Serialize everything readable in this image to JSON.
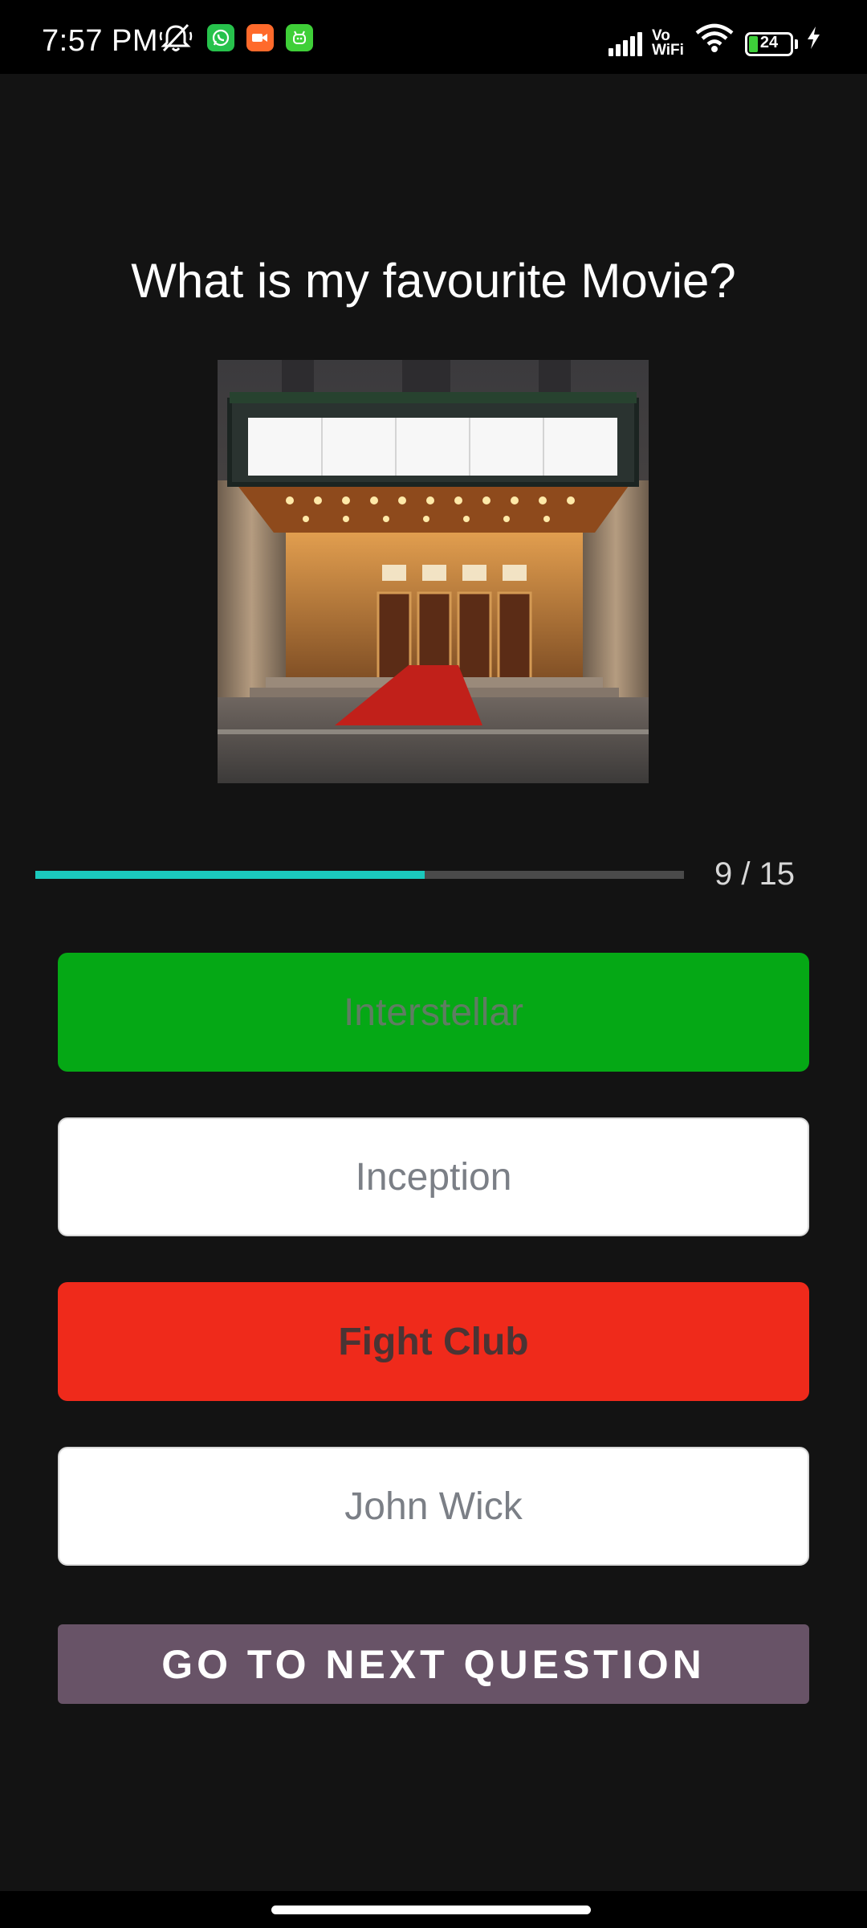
{
  "status_bar": {
    "time": "7:57 PM",
    "vowifi_top": "Vo",
    "vowifi_bottom": "WiFi",
    "battery_level": "24",
    "icons": [
      "mute-bell-icon",
      "whatsapp-icon",
      "video-call-icon",
      "android-app-icon",
      "signal-icon",
      "vowifi-icon",
      "wifi-icon",
      "battery-icon",
      "charging-bolt-icon"
    ],
    "colors": {
      "whatsapp": "#27c24c",
      "video_app": "#ff6a2b",
      "android_app": "#3fcf38",
      "battery": "#3ecf3a"
    }
  },
  "quiz": {
    "question": "What is my favourite Movie?",
    "image_icon": "movie-theater-image",
    "progress": {
      "current": 9,
      "total": 15,
      "label": "9 / 15",
      "bar_fraction": 0.6,
      "fill_color": "#1bc9bd"
    },
    "options": [
      {
        "label": "Interstellar",
        "state": "correct",
        "color": "#05a815"
      },
      {
        "label": "Inception",
        "state": "neutral",
        "color": "#ffffff"
      },
      {
        "label": "Fight Club",
        "state": "wrong",
        "color": "#ef2a1b"
      },
      {
        "label": "John Wick",
        "state": "neutral",
        "color": "#ffffff"
      }
    ],
    "next_button_label": "GO TO NEXT QUESTION",
    "next_button_color": "#685367"
  }
}
